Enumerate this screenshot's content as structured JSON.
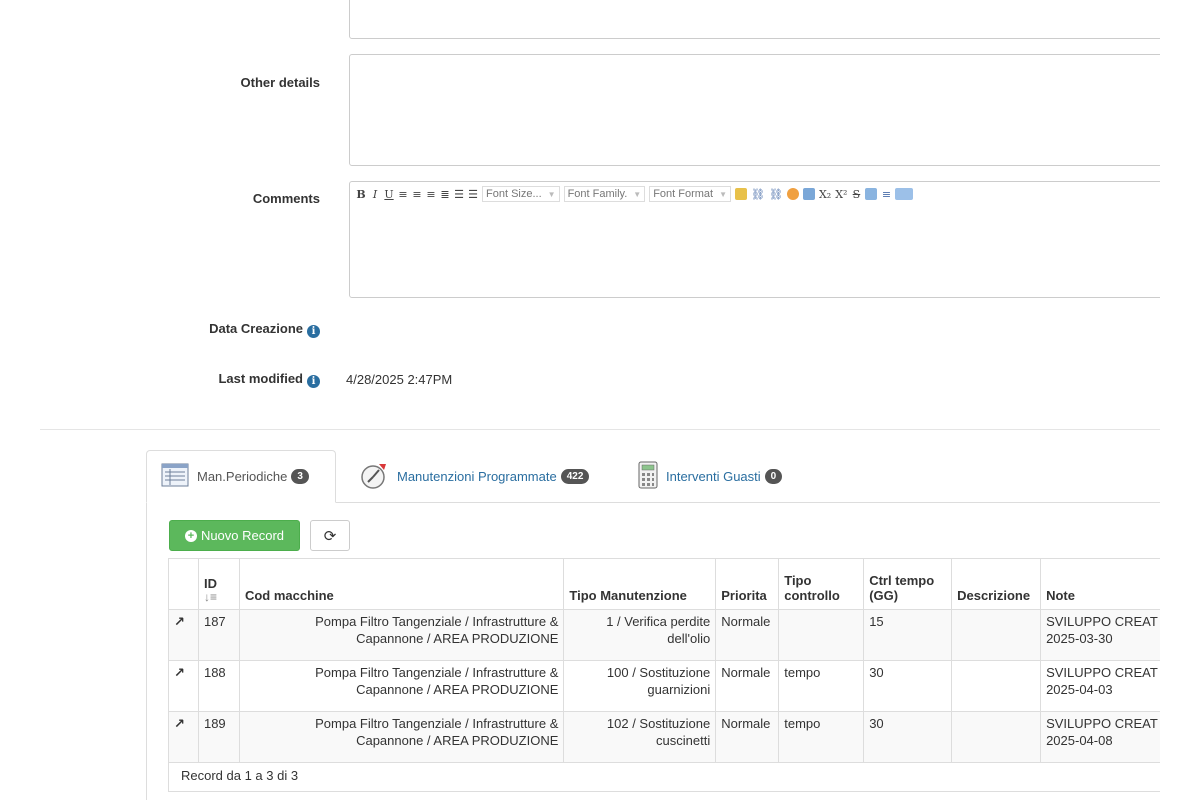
{
  "form": {
    "other_details_label": "Other details",
    "comments_label": "Comments",
    "created_label": "Data Creazione",
    "modified_label": "Last modified",
    "modified_value": "4/28/2025 2:47PM"
  },
  "editor": {
    "font_size": "Font Size...",
    "font_family": "Font Family.",
    "font_format": "Font Format",
    "bold": "B",
    "italic": "I",
    "underline": "U",
    "subscript": "X₂",
    "superscript": "X²",
    "strike": "S"
  },
  "tabs": [
    {
      "label": "Man.Periodiche",
      "count": "3"
    },
    {
      "label": "Manutenzioni Programmate",
      "count": "422"
    },
    {
      "label": "Interventi Guasti",
      "count": "0"
    }
  ],
  "toolbar": {
    "new_record": "Nuovo Record",
    "refresh_icon": "refresh-icon"
  },
  "table": {
    "headers": {
      "id": "ID",
      "cod": "Cod macchine",
      "tipo_man": "Tipo Manutenzione",
      "priorita": "Priorita",
      "tipo_ctrl_1": "Tipo",
      "tipo_ctrl_2": "controllo",
      "ctrl_tempo_1": "Ctrl tempo",
      "ctrl_tempo_2": "(GG)",
      "descrizione": "Descrizione",
      "note": "Note"
    },
    "rows": [
      {
        "id": "187",
        "cod1": "Pompa Filtro Tangenziale / Infrastrutture &",
        "cod2": "Capannone / AREA PRODUZIONE",
        "tipo1": "1 / Verifica perdite",
        "tipo2": "dell'olio",
        "priorita": "Normale",
        "tipo_ctrl": "",
        "ctrl_tempo": "15",
        "descrizione": "",
        "note1": "SVILUPPO CREAT",
        "note2": "2025-03-30"
      },
      {
        "id": "188",
        "cod1": "Pompa Filtro Tangenziale / Infrastrutture &",
        "cod2": "Capannone / AREA PRODUZIONE",
        "tipo1": "100 / Sostituzione",
        "tipo2": "guarnizioni",
        "priorita": "Normale",
        "tipo_ctrl": "tempo",
        "ctrl_tempo": "30",
        "descrizione": "",
        "note1": "SVILUPPO CREAT",
        "note2": "2025-04-03"
      },
      {
        "id": "189",
        "cod1": "Pompa Filtro Tangenziale / Infrastrutture &",
        "cod2": "Capannone / AREA PRODUZIONE",
        "tipo1": "102 / Sostituzione",
        "tipo2": "cuscinetti",
        "priorita": "Normale",
        "tipo_ctrl": "tempo",
        "ctrl_tempo": "30",
        "descrizione": "",
        "note1": "SVILUPPO CREAT",
        "note2": "2025-04-08"
      }
    ],
    "footer": "Record da 1 a 3 di 3"
  }
}
